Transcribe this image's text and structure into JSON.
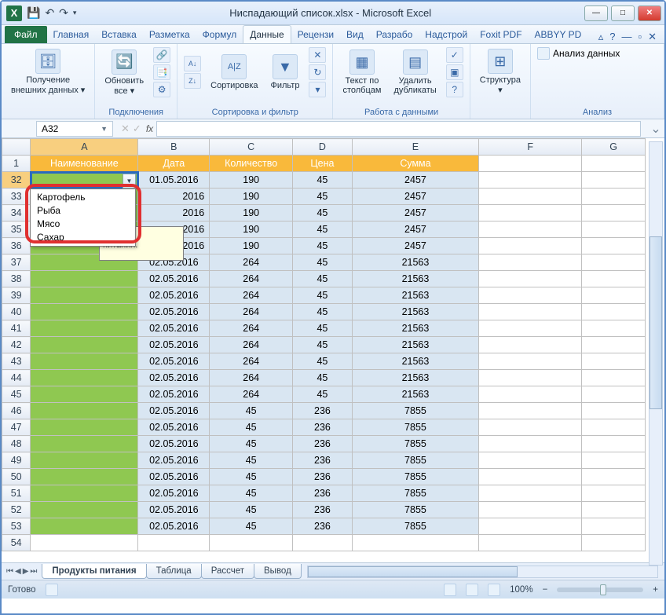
{
  "window": {
    "title": "Ниспадающий список.xlsx - Microsoft Excel",
    "qat_save": "💾",
    "qat_undo": "↶",
    "qat_redo": "↷"
  },
  "tabs": {
    "file": "Файл",
    "items": [
      "Главная",
      "Вставка",
      "Разметка",
      "Формул",
      "Данные",
      "Рецензи",
      "Вид",
      "Разрабо",
      "Надстрой",
      "Foxit PDF",
      "ABBYY PD"
    ],
    "active_index": 4
  },
  "ribbon": {
    "g0": {
      "btn": "Получение\nвнешних данных ▾",
      "label": ""
    },
    "g1": {
      "btn": "Обновить\nвсе ▾",
      "label": "Подключения"
    },
    "g2": {
      "sort_btn": "Сортировка",
      "filter_btn": "Фильтр",
      "label": "Сортировка и фильтр"
    },
    "g3": {
      "t2c": "Текст по\nстолбцам",
      "dup": "Удалить\nдубликаты",
      "label": "Работа с данными"
    },
    "g4": {
      "btn": "Структура\n▾",
      "label": ""
    },
    "g5": {
      "btn": "Анализ данных",
      "label": "Анализ"
    }
  },
  "fx": {
    "name": "A32",
    "fx": "fx",
    "formula": ""
  },
  "grid": {
    "cols": [
      "A",
      "B",
      "C",
      "D",
      "E",
      "F",
      "G"
    ],
    "headers": [
      "Наименование",
      "Дата",
      "Количество",
      "Цена",
      "Сумма"
    ],
    "row_start": 32,
    "rows": [
      [
        "",
        "01.05.2016",
        "190",
        "45",
        "2457"
      ],
      [
        "",
        "",
        "190",
        "45",
        "2457"
      ],
      [
        "",
        "",
        "190",
        "45",
        "2457"
      ],
      [
        "",
        "",
        "190",
        "45",
        "2457"
      ],
      [
        "",
        "",
        "190",
        "45",
        "2457"
      ],
      [
        "",
        "02.05.2016",
        "264",
        "45",
        "21563"
      ],
      [
        "",
        "02.05.2016",
        "264",
        "45",
        "21563"
      ],
      [
        "",
        "02.05.2016",
        "264",
        "45",
        "21563"
      ],
      [
        "",
        "02.05.2016",
        "264",
        "45",
        "21563"
      ],
      [
        "",
        "02.05.2016",
        "264",
        "45",
        "21563"
      ],
      [
        "",
        "02.05.2016",
        "264",
        "45",
        "21563"
      ],
      [
        "",
        "02.05.2016",
        "264",
        "45",
        "21563"
      ],
      [
        "",
        "02.05.2016",
        "264",
        "45",
        "21563"
      ],
      [
        "",
        "02.05.2016",
        "264",
        "45",
        "21563"
      ],
      [
        "",
        "02.05.2016",
        "45",
        "236",
        "7855"
      ],
      [
        "",
        "02.05.2016",
        "45",
        "236",
        "7855"
      ],
      [
        "",
        "02.05.2016",
        "45",
        "236",
        "7855"
      ],
      [
        "",
        "02.05.2016",
        "45",
        "236",
        "7855"
      ],
      [
        "",
        "02.05.2016",
        "45",
        "236",
        "7855"
      ],
      [
        "",
        "02.05.2016",
        "45",
        "236",
        "7855"
      ],
      [
        "",
        "02.05.2016",
        "45",
        "236",
        "7855"
      ],
      [
        "",
        "02.05.2016",
        "45",
        "236",
        "7855"
      ]
    ],
    "dropdown": [
      "Картофель",
      "Рыба",
      "Мясо",
      "Сахар"
    ],
    "tooltip_line1": "риант",
    "tooltip_line2": "питания.",
    "partial_date": "2016"
  },
  "sheets": {
    "tabs": [
      "Продукты питания",
      "Таблица",
      "Рассчет",
      "Вывод"
    ],
    "active_index": 0
  },
  "status": {
    "ready": "Готово",
    "zoom": "100%",
    "minus": "−",
    "plus": "+"
  }
}
